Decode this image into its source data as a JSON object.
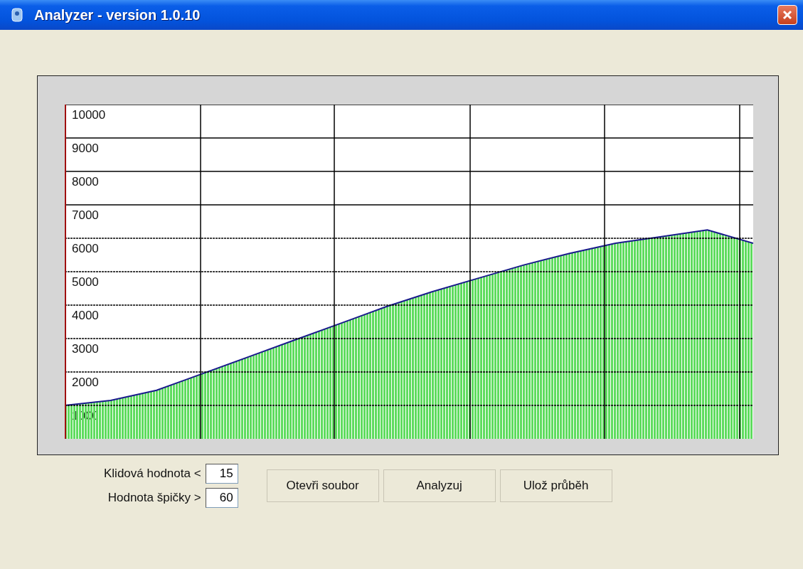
{
  "window": {
    "title": "Analyzer - version 1.0.10"
  },
  "chart": {
    "chart_data": {
      "type": "area",
      "grid": true,
      "ylim": [
        0,
        10000
      ],
      "yticks": [
        1000,
        2000,
        3000,
        4000,
        5000,
        6000,
        7000,
        8000,
        9000,
        10000
      ],
      "series": [
        {
          "color": "#5fdc5f",
          "values": [
            1000,
            1150,
            1450,
            1950,
            2450,
            2950,
            3450,
            3950,
            4400,
            4800,
            5200,
            5550,
            5850,
            6050,
            6250,
            5850
          ]
        }
      ]
    }
  },
  "fields": [
    {
      "label": "Klidová hodnota <",
      "value": "15"
    },
    {
      "label": "Hodnota špičky >",
      "value": "60"
    }
  ],
  "buttons": [
    "Otevři soubor",
    "Analyzuj",
    "Ulož průběh"
  ]
}
